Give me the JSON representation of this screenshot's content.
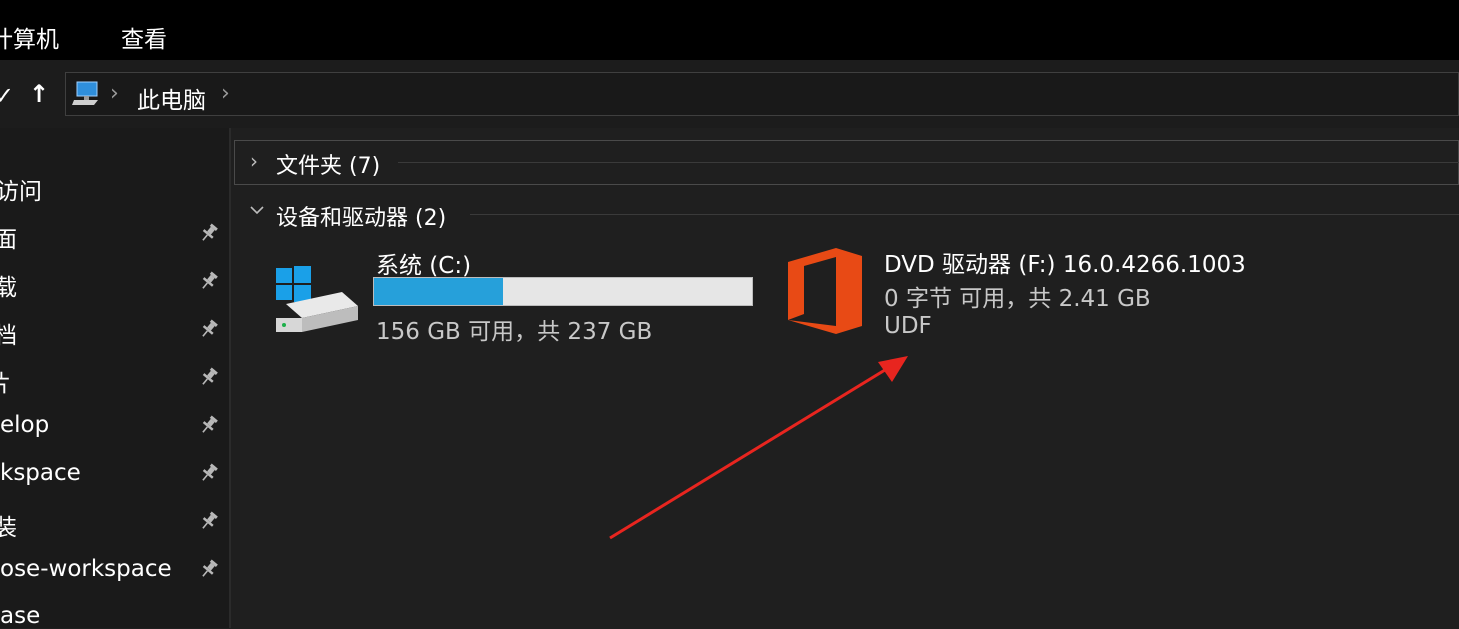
{
  "menu": {
    "items": [
      "计算机",
      "查看"
    ]
  },
  "nav": {
    "back_glyph": "✓",
    "up_glyph": "↑"
  },
  "address": {
    "location": "此电脑",
    "sep": "›",
    "icon": "computer-icon"
  },
  "sidebar": {
    "quick_access_label": "访问",
    "items": [
      {
        "label": "面",
        "pinned": true
      },
      {
        "label": "载",
        "pinned": true
      },
      {
        "label": "档",
        "pinned": true
      },
      {
        "label": "片",
        "pinned": true
      },
      {
        "label": "elop",
        "pinned": true
      },
      {
        "label": "kspace",
        "pinned": true
      },
      {
        "label": "装",
        "pinned": true
      },
      {
        "label": "ose-workspace",
        "pinned": true
      },
      {
        "label": "ase",
        "pinned": false
      }
    ]
  },
  "groups": {
    "folders": {
      "title": "文件夹 (7)",
      "expanded": false
    },
    "devices": {
      "title": "设备和驱动器 (2)",
      "expanded": true
    }
  },
  "drives": {
    "c": {
      "name": "系统 (C:)",
      "space": "156 GB 可用，共 237 GB",
      "used_fraction": 0.342,
      "icon": "windows-drive-icon"
    },
    "f": {
      "name": "DVD 驱动器 (F:) 16.0.4266.1003",
      "space": "0 字节 可用，共 2.41 GB",
      "fs": "UDF",
      "icon": "office-logo-icon"
    }
  },
  "colors": {
    "accent": "#26a0da",
    "office": "#e84a15",
    "arrow": "#e8251f",
    "background": "#1f1f1f"
  }
}
